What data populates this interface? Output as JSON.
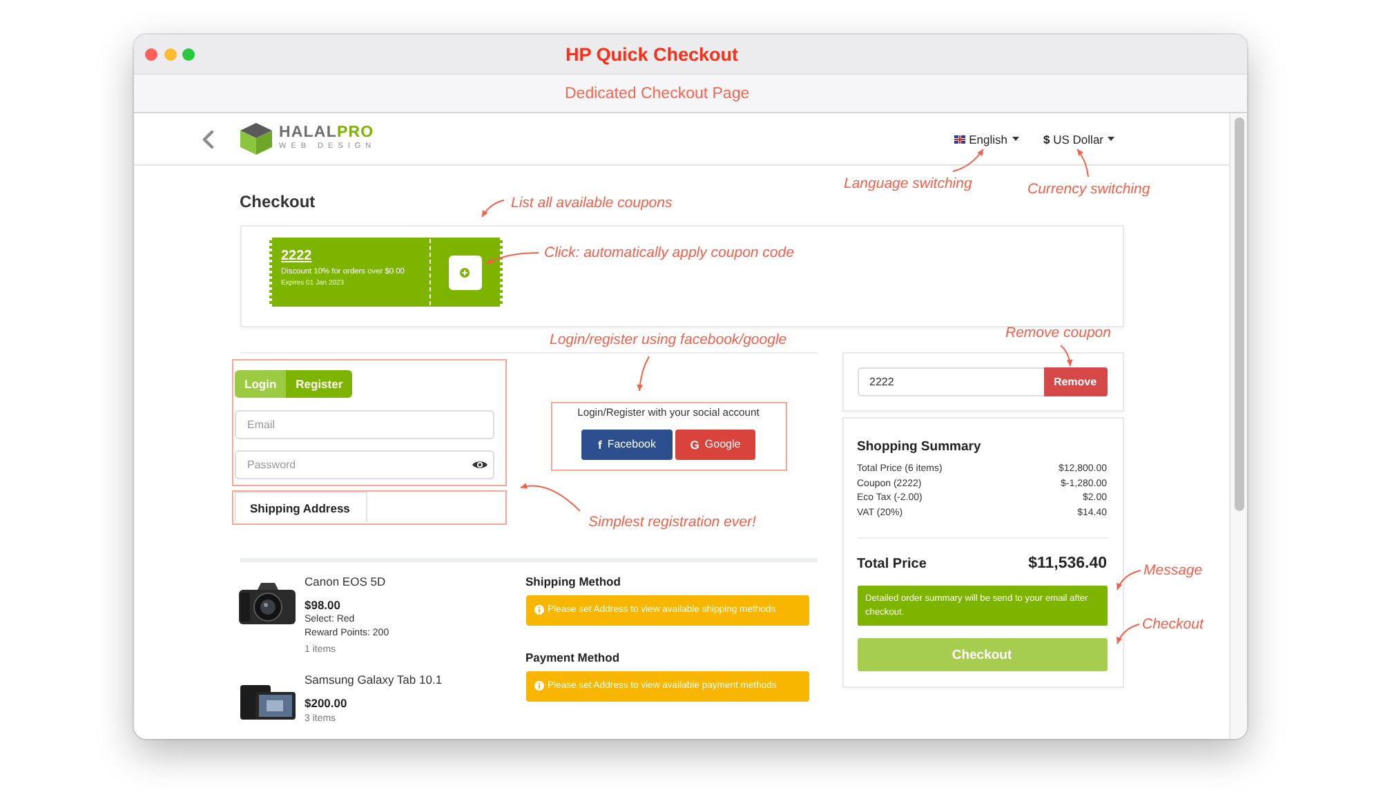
{
  "window": {
    "title": "HP Quick Checkout",
    "subtitle": "Dedicated Checkout Page"
  },
  "header": {
    "logo": {
      "wordmark": "HALAL**PRO**",
      "tagline": "WEB DESIGN"
    },
    "language": "English",
    "currency": "**$** US Dollar"
  },
  "checkout": {
    "title": "Checkout",
    "coupons": [
      {
        "code": "2222",
        "description": "Discount 10% for orders over $0.00",
        "expires": "Expires 01 Jan 2023"
      }
    ]
  },
  "account": {
    "tabs": [
      {
        "label": "Login",
        "selected": true
      },
      {
        "label": "Register",
        "selected": false
      }
    ],
    "fields": [
      {
        "kind": "email",
        "placeholder": "Email"
      },
      {
        "kind": "password",
        "placeholder": "Password"
      }
    ],
    "shipping_tab": "Shipping Address"
  },
  "social": {
    "prompt": "Login/Register with your social account",
    "buttons": [
      {
        "kind": "facebook",
        "icon": "f",
        "label": "Facebook"
      },
      {
        "kind": "google",
        "icon": "G",
        "label": "Google"
      }
    ]
  },
  "products": [
    {
      "kind": "camera",
      "name": "Canon EOS 5D",
      "price": "$98.00",
      "options": [
        "Select: Red",
        "Reward Points: 200"
      ],
      "quantity": "1 items"
    },
    {
      "kind": "tablet",
      "name": "Samsung Galaxy Tab 10.1",
      "price": "$200.00",
      "quantity": "3 items"
    }
  ],
  "methods": [
    {
      "title": "Shipping Method",
      "alert": "Please set Address to view available shipping methods"
    },
    {
      "title": "Payment Method",
      "alert": "Please set Address to view available payment methods"
    }
  ],
  "coupon_form": {
    "value": "2222",
    "button": "Remove"
  },
  "summary": {
    "title": "Shopping Summary",
    "rows": [
      {
        "label": "Total Price (6 items)",
        "value": "$12,800.00"
      },
      {
        "label": "Coupon (2222)",
        "value": "$-1,280.00"
      },
      {
        "label": "Eco Tax (-2.00)",
        "value": "$2.00"
      },
      {
        "label": "VAT (20%)",
        "value": "$14.40"
      }
    ],
    "total": {
      "label": "Total Price",
      "value": "$11,536.40"
    },
    "message": "Detailed order summary will be send to your email after checkout.",
    "button": "Checkout"
  },
  "annotations": [
    {
      "text": "Language switching"
    },
    {
      "text": "Currency switching"
    },
    {
      "text": "List all available coupons"
    },
    {
      "text": "Click: automatically apply coupon code"
    },
    {
      "text": "Remove coupon"
    },
    {
      "text": "Login/register using facebook/google"
    },
    {
      "text": "Simplest registration ever!"
    },
    {
      "text": "Message"
    },
    {
      "text": "Checkout"
    }
  ]
}
